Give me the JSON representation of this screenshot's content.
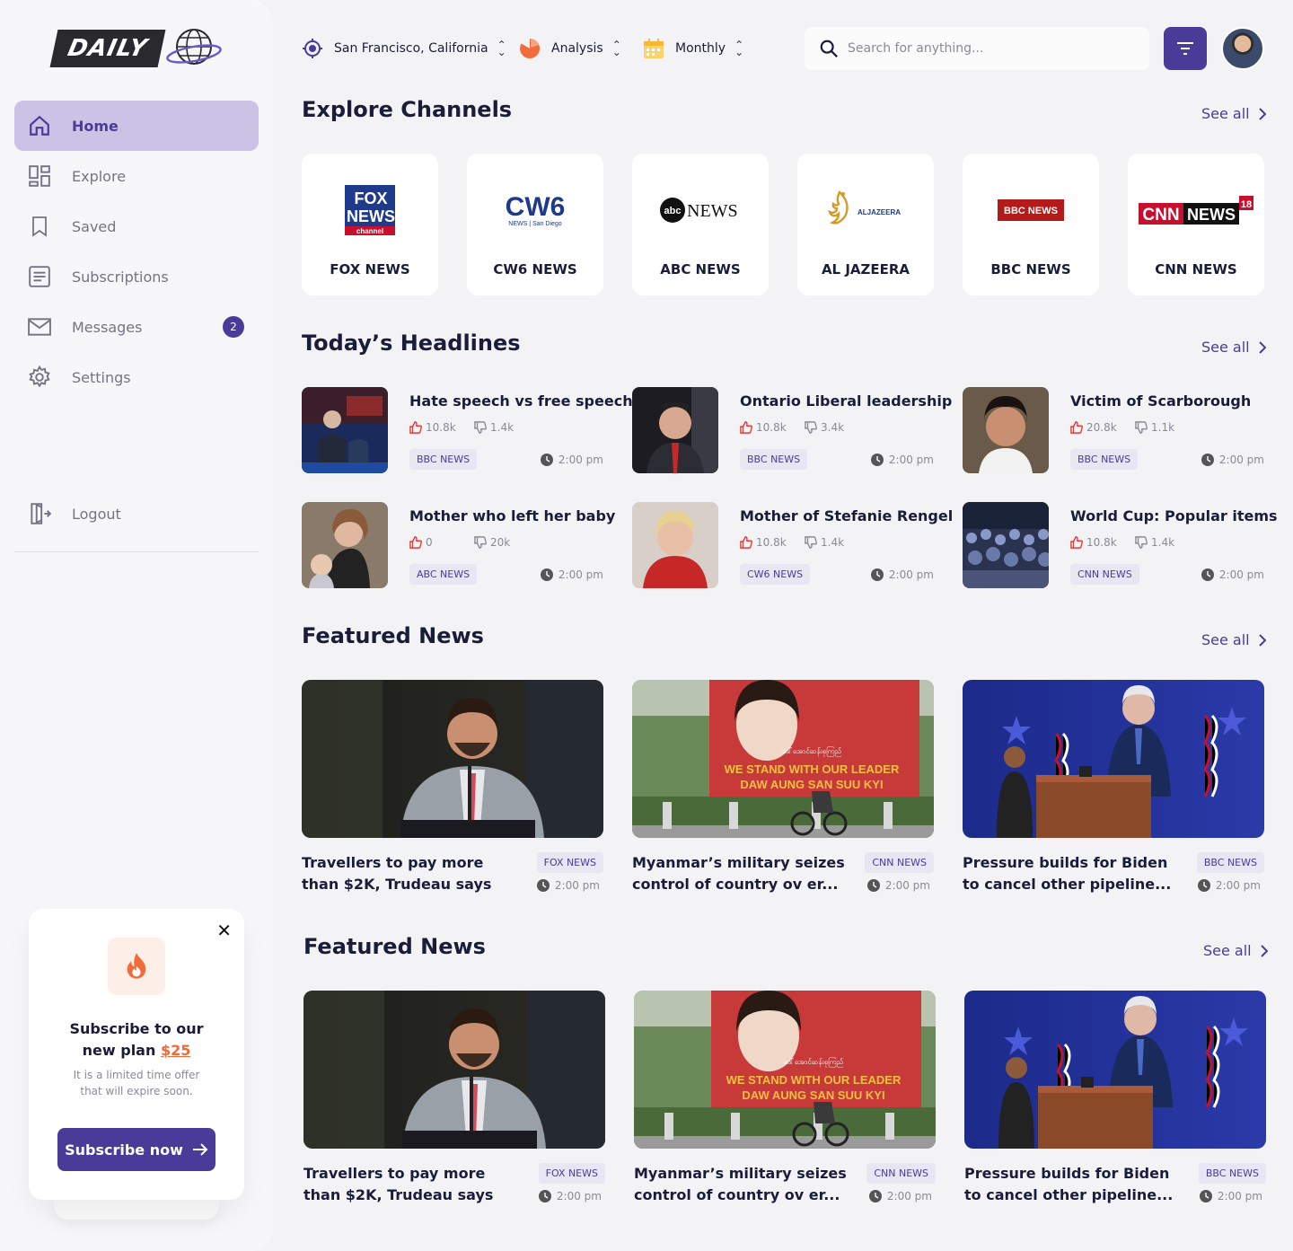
{
  "brand": {
    "logo_text": "DAILY"
  },
  "nav": {
    "items": [
      {
        "label": "Home",
        "icon": "home-icon",
        "active": true
      },
      {
        "label": "Explore",
        "icon": "explore-icon"
      },
      {
        "label": "Saved",
        "icon": "bookmark-icon"
      },
      {
        "label": "Subscriptions",
        "icon": "subscriptions-icon"
      },
      {
        "label": "Messages",
        "icon": "mail-icon",
        "badge": "2"
      },
      {
        "label": "Settings",
        "icon": "gear-icon"
      }
    ],
    "logout": "Logout"
  },
  "promo": {
    "title_a": "Subscribe to our",
    "title_b": "new plan",
    "price": "$25",
    "desc": "It is a limited time offer that will expire soon.",
    "button": "Subscribe now"
  },
  "topbar": {
    "location": "San Francisco, California",
    "analysis": "Analysis",
    "period": "Monthly",
    "search_placeholder": "Search for anything..."
  },
  "sections": {
    "channels": "Explore Channels",
    "headlines": "Today’s Headlines",
    "featured": "Featured News",
    "featured2": "Featured News",
    "see_all": "See all"
  },
  "channels": [
    {
      "name": "FOX NEWS"
    },
    {
      "name": "CW6 NEWS"
    },
    {
      "name": "ABC NEWS"
    },
    {
      "name": "AL JAZEERA"
    },
    {
      "name": "BBC NEWS"
    },
    {
      "name": "CNN NEWS"
    }
  ],
  "channel_logos": {
    "fox_a": "FOX",
    "fox_b": "NEWS",
    "fox_c": "channel",
    "cw_a": "CW6",
    "cw_b": "NEWS | San Diego",
    "abc_a": "abc",
    "abc_b": "NEWS",
    "alj": "ALJAZEERA",
    "bbc": "BBC NEWS",
    "cnn_a": "CNN",
    "cnn_b": "NEWS",
    "cnn_c": "18"
  },
  "headlines": [
    {
      "title": "Hate speech vs free speech",
      "likes": "10.8k",
      "dislikes": "1.4k",
      "source": "BBC NEWS",
      "time": "2:00 pm"
    },
    {
      "title": "Ontario Liberal leadership",
      "likes": "10.8k",
      "dislikes": "3.4k",
      "source": "BBC NEWS",
      "time": "2:00 pm"
    },
    {
      "title": "Victim of Scarborough",
      "likes": "20.8k",
      "dislikes": "1.1k",
      "source": "BBC NEWS",
      "time": "2:00 pm"
    },
    {
      "title": "Mother who left her baby",
      "likes": "0",
      "dislikes": "20k",
      "source": "ABC NEWS",
      "time": "2:00 pm"
    },
    {
      "title": "Mother of Stefanie Rengel",
      "likes": "10.8k",
      "dislikes": "1.4k",
      "source": "CW6 NEWS",
      "time": "2:00 pm"
    },
    {
      "title": "World   Cup: Popular items",
      "likes": "10.8k",
      "dislikes": "1.4k",
      "source": "CNN NEWS",
      "time": "2:00 pm"
    }
  ],
  "featured": [
    {
      "title": "Travellers to pay more than $2K, Trudeau says",
      "source": "FOX NEWS",
      "time": "2:00 pm"
    },
    {
      "title": "Myanmar’s military seizes control of country ov   er...",
      "source": "CNN NEWS",
      "time": "2:00 pm",
      "banner_a": "WE STAND WITH OUR LEADER",
      "banner_b": "DAW AUNG SAN SUU KYI"
    },
    {
      "title": "Pressure builds for Biden to cancel other pipeline...",
      "source": "BBC NEWS",
      "time": "2:00 pm"
    }
  ],
  "featured2": [
    {
      "title": "Travellers to pay more than $2K, Trudeau says",
      "source": "FOX NEWS",
      "time": "2:00 pm"
    },
    {
      "title": "Myanmar’s military seizes control of country ov   er...",
      "source": "CNN NEWS",
      "time": "2:00 pm",
      "banner_a": "WE STAND WITH OUR LEADER",
      "banner_b": "DAW AUNG SAN SUU KYI"
    },
    {
      "title": "Pressure builds for Biden to cancel other pipeline...",
      "source": "BBC NEWS",
      "time": "2:00 pm"
    }
  ],
  "colors": {
    "accent": "#4a3b98",
    "accent_light": "#cbc3e6",
    "promo_price": "#f06a3a",
    "like_red": "#e53935"
  }
}
